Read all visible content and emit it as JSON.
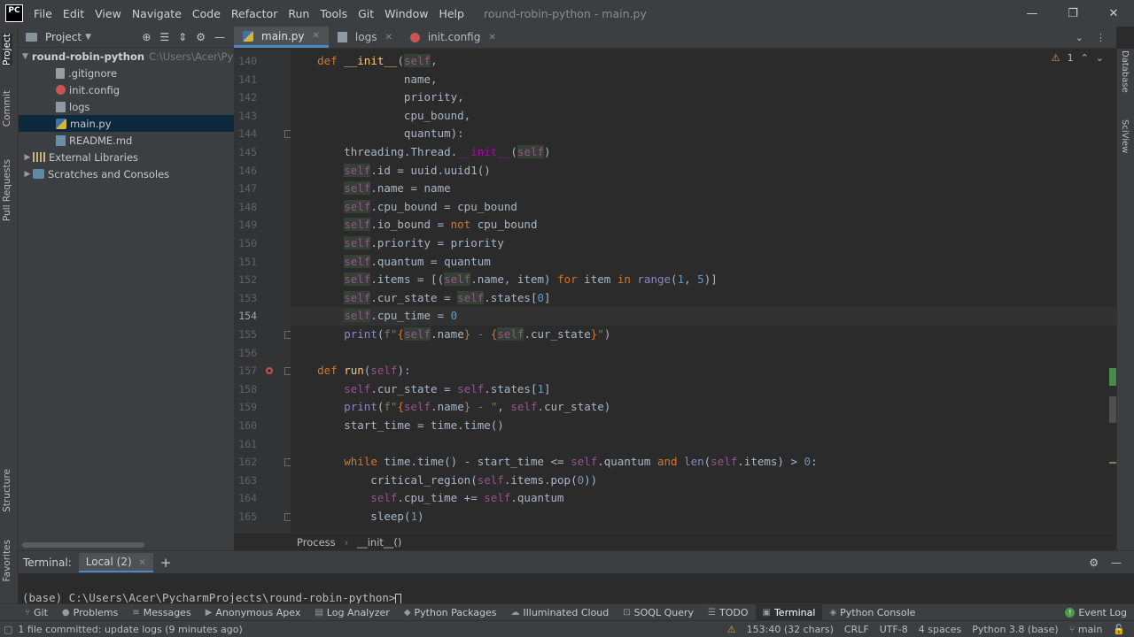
{
  "app": {
    "logo": "PC",
    "window_title": "round-robin-python - main.py",
    "menu": [
      "File",
      "Edit",
      "View",
      "Navigate",
      "Code",
      "Refactor",
      "Run",
      "Tools",
      "Git",
      "Window",
      "Help"
    ],
    "window_controls": [
      "—",
      "❐",
      "✕"
    ]
  },
  "left_strip": [
    "Project",
    "Commit",
    "Pull Requests",
    "Structure",
    "Favorites"
  ],
  "right_strip": [
    "Database",
    "SciView"
  ],
  "project_panel": {
    "title": "Project",
    "root": {
      "name": "round-robin-python",
      "path": "C:\\Users\\Acer\\Pych"
    },
    "files": [
      {
        "name": ".gitignore",
        "icon": "gitignore-file-icon"
      },
      {
        "name": "init.config",
        "icon": "config-file-icon"
      },
      {
        "name": "logs",
        "icon": "text-file-icon"
      },
      {
        "name": "main.py",
        "icon": "python-file-icon",
        "selected": true
      },
      {
        "name": "README.md",
        "icon": "markdown-file-icon"
      }
    ],
    "extra": [
      "External Libraries",
      "Scratches and Consoles"
    ]
  },
  "tabs": [
    {
      "label": "main.py",
      "active": true
    },
    {
      "label": "logs",
      "active": false
    },
    {
      "label": "init.config",
      "active": false
    }
  ],
  "inspection": {
    "count": "1"
  },
  "editor": {
    "current_line": "154",
    "lines": [
      {
        "n": "140",
        "html": "    <span class=\"kw\">def</span> <span class=\"fn\">__init__</span>(<span class=\"sf self-hl\">self</span>,"
      },
      {
        "n": "141",
        "html": "                 name,"
      },
      {
        "n": "142",
        "html": "                 priority,"
      },
      {
        "n": "143",
        "html": "                 cpu_bound,"
      },
      {
        "n": "144",
        "html": "                 quantum):"
      },
      {
        "n": "145",
        "html": "        threading.Thread.<span class=\"dunder\">__init__</span>(<span class=\"sf self-hl\">self</span>)"
      },
      {
        "n": "146",
        "html": "        <span class=\"sf self-hl\">self</span>.id = uuid.uuid1()"
      },
      {
        "n": "147",
        "html": "        <span class=\"sf self-hl\">self</span>.name = name"
      },
      {
        "n": "148",
        "html": "        <span class=\"sf self-hl\">self</span>.cpu_bound = cpu_bound"
      },
      {
        "n": "149",
        "html": "        <span class=\"sf self-hl\">self</span>.io_bound = <span class=\"kw\">not</span> cpu_bound"
      },
      {
        "n": "150",
        "html": "        <span class=\"sf self-hl\">self</span>.priority = priority"
      },
      {
        "n": "151",
        "html": "        <span class=\"sf self-hl\">self</span>.quantum = quantum"
      },
      {
        "n": "152",
        "html": "        <span class=\"sf self-hl\">self</span>.items = [(<span class=\"sf self-hl\">self</span>.name, item) <span class=\"kw\">for</span> item <span class=\"kw\">in</span> <span class=\"bi\">range</span>(<span class=\"num\">1</span>, <span class=\"num\">5</span>)]"
      },
      {
        "n": "153",
        "html": "        <span class=\"sf self-hl\">self</span>.cur_state = <span class=\"sf self-hl\">self</span>.states[<span class=\"num\">0</span>]"
      },
      {
        "n": "154",
        "html": "        <span class=\"sf self-hl\">self</span>.cpu_time = <span class=\"num\">0</span>"
      },
      {
        "n": "155",
        "html": "        <span class=\"bi\">print</span>(<span class=\"str\">f\"</span><span class=\"fstr-brace\">{</span><span class=\"sf self-hl\">self</span>.name<span class=\"fstr-brace\">}</span><span class=\"str\"> - </span><span class=\"fstr-brace\">{</span><span class=\"sf self-hl\">self</span>.cur_state<span class=\"fstr-brace\">}</span><span class=\"str\">\"</span>)"
      },
      {
        "n": "156",
        "html": ""
      },
      {
        "n": "157",
        "html": "    <span class=\"kw\">def</span> <span class=\"fn\">run</span>(<span class=\"sf\">self</span>):"
      },
      {
        "n": "158",
        "html": "        <span class=\"sf\">self</span>.cur_state = <span class=\"sf\">self</span>.states[<span class=\"num\">1</span>]"
      },
      {
        "n": "159",
        "html": "        <span class=\"bi\">print</span>(<span class=\"str\">f\"</span><span class=\"fstr-brace\">{</span><span class=\"sf\">self</span>.name<span class=\"fstr-brace\">}</span><span class=\"str\"> - \"</span>, <span class=\"sf\">self</span>.cur_state)"
      },
      {
        "n": "160",
        "html": "        start_time = time.time()"
      },
      {
        "n": "161",
        "html": ""
      },
      {
        "n": "162",
        "html": "        <span class=\"kw\">while</span> time.time() - start_time &lt;= <span class=\"sf\">self</span>.quantum <span class=\"kw\">and</span> <span class=\"bi\">len</span>(<span class=\"sf\">self</span>.items) &gt; <span class=\"num\">0</span>:"
      },
      {
        "n": "163",
        "html": "            critical_region(<span class=\"sf\">self</span>.items.pop(<span class=\"num\">0</span>))"
      },
      {
        "n": "164",
        "html": "            <span class=\"sf\">self</span>.cpu_time += <span class=\"sf\">self</span>.quantum"
      },
      {
        "n": "165",
        "html": "            sleep(<span class=\"num\">1</span>)"
      }
    ]
  },
  "breadcrumb": [
    "Process",
    "__init__()"
  ],
  "terminal": {
    "label": "Terminal:",
    "tab": "Local (2)",
    "prompt": "(base) C:\\Users\\Acer\\PycharmProjects\\round-robin-python>"
  },
  "tool_windows": [
    {
      "label": "Git",
      "icon": "git-icon"
    },
    {
      "label": "Problems",
      "icon": "problems-icon"
    },
    {
      "label": "Messages",
      "icon": "messages-icon"
    },
    {
      "label": "Anonymous Apex",
      "icon": "apex-icon"
    },
    {
      "label": "Log Analyzer",
      "icon": "log-analyzer-icon"
    },
    {
      "label": "Python Packages",
      "icon": "packages-icon"
    },
    {
      "label": "Illuminated Cloud",
      "icon": "cloud-icon"
    },
    {
      "label": "SOQL Query",
      "icon": "soql-icon"
    },
    {
      "label": "TODO",
      "icon": "todo-icon"
    },
    {
      "label": "Terminal",
      "icon": "terminal-icon",
      "active": true
    },
    {
      "label": "Python Console",
      "icon": "python-console-icon"
    }
  ],
  "event_log": "Event Log",
  "status": {
    "message": "1 file committed: update logs (9 minutes ago)",
    "position": "153:40 (32 chars)",
    "line_sep": "CRLF",
    "encoding": "UTF-8",
    "indent": "4 spaces",
    "interpreter": "Python 3.8 (base)",
    "branch": "main"
  }
}
